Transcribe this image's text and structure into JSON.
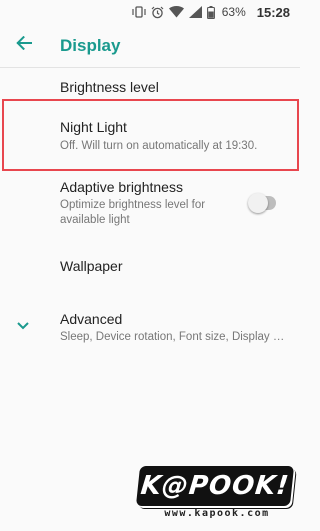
{
  "status_bar": {
    "icons": [
      "vibrate-icon",
      "alarm-icon",
      "wifi-icon",
      "signal-icon",
      "battery-icon"
    ],
    "battery_percent": "63%",
    "time": "15:28"
  },
  "app_bar": {
    "title": "Display",
    "accent_color": "#1a9a8e"
  },
  "settings": {
    "brightness": {
      "title": "Brightness level"
    },
    "night_light": {
      "title": "Night Light",
      "summary": "Off. Will turn on automatically at 19:30."
    },
    "adaptive": {
      "title": "Adaptive brightness",
      "summary_line1": "Optimize brightness level for",
      "summary_line2": "available light",
      "enabled": false
    },
    "wallpaper": {
      "title": "Wallpaper"
    },
    "advanced": {
      "title": "Advanced",
      "summary": "Sleep, Device rotation, Font size, Display si..."
    }
  },
  "highlight_color": "#e8464e",
  "watermark": {
    "logo": "K@POOK!",
    "url": "www.kapook.com"
  }
}
